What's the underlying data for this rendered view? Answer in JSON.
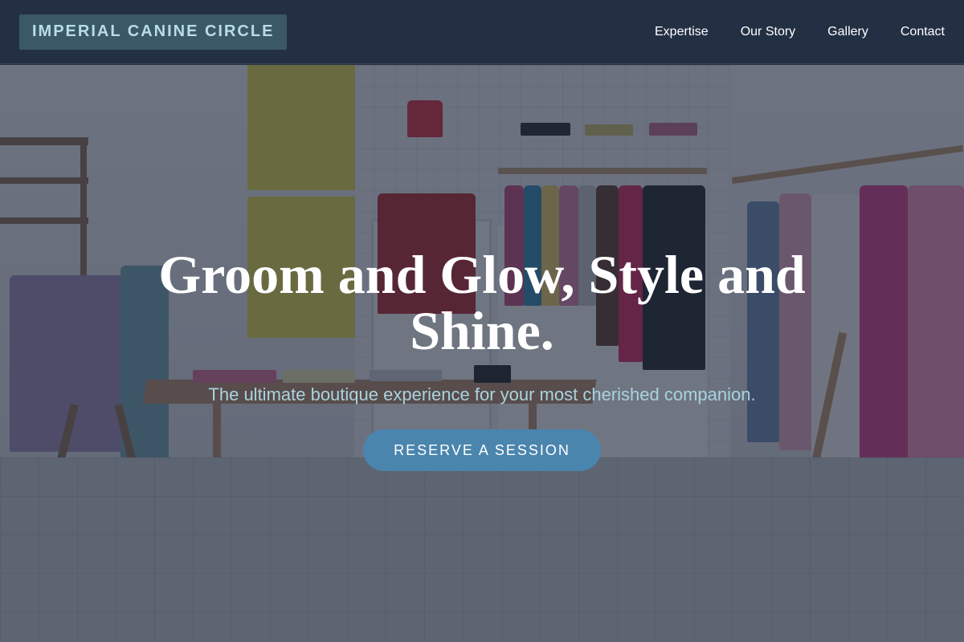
{
  "header": {
    "logo": "IMPERIAL CANINE CIRCLE",
    "nav": [
      {
        "label": "Expertise"
      },
      {
        "label": "Our Story"
      },
      {
        "label": "Gallery"
      },
      {
        "label": "Contact"
      }
    ]
  },
  "hero": {
    "headline": "Groom and Glow, Style and Shine.",
    "subline": "The ultimate boutique experience for your most cherished companion.",
    "cta_label": "RESERVE A SESSION",
    "background_image": "clothing boutique interior photo with dark overlay"
  },
  "colors": {
    "header_bg": "#233044",
    "logo_bg": "#3a5866",
    "logo_text": "#b8dde6",
    "subline_text": "#a9d3df",
    "cta_bg": "#4a85ad"
  }
}
